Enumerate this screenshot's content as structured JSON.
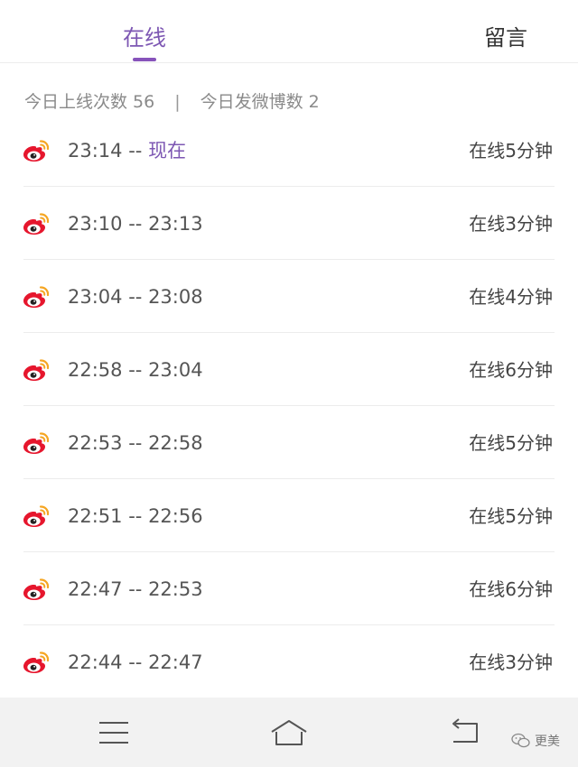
{
  "tabs": [
    {
      "label": "在线",
      "active": true
    },
    {
      "label": "留言",
      "active": false
    }
  ],
  "summary": {
    "online_count_label": "今日上线次数 56",
    "separator": "|",
    "post_count_label": "今日发微博数 2"
  },
  "sessions": [
    {
      "start": "23:14",
      "dash": "--",
      "end": "现在",
      "duration": "在线5分钟"
    },
    {
      "start": "23:10",
      "dash": "--",
      "end": "23:13",
      "duration": "在线3分钟"
    },
    {
      "start": "23:04",
      "dash": "--",
      "end": "23:08",
      "duration": "在线4分钟"
    },
    {
      "start": "22:58",
      "dash": "--",
      "end": "23:04",
      "duration": "在线6分钟"
    },
    {
      "start": "22:53",
      "dash": "--",
      "end": "22:58",
      "duration": "在线5分钟"
    },
    {
      "start": "22:51",
      "dash": "--",
      "end": "22:56",
      "duration": "在线5分钟"
    },
    {
      "start": "22:47",
      "dash": "--",
      "end": "22:53",
      "duration": "在线6分钟"
    },
    {
      "start": "22:44",
      "dash": "--",
      "end": "22:47",
      "duration": "在线3分钟"
    }
  ],
  "icons": {
    "session": "weibo-icon",
    "menu": "menu-icon",
    "home": "home-icon",
    "back": "back-icon",
    "watermark": "wechat-icon"
  },
  "watermark": {
    "text": "更美"
  },
  "colors": {
    "accent": "#7d57b3",
    "weibo_red": "#e6162d",
    "weibo_orange": "#f5a623"
  }
}
